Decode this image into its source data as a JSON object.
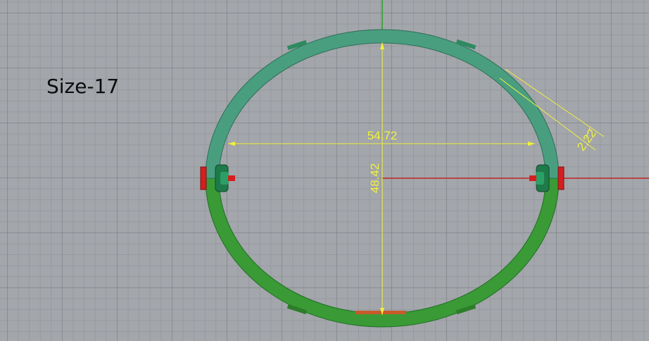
{
  "viewport": {
    "size_label": "Size-17",
    "colors": {
      "background": "#a3a6ab",
      "ring_upper": "#3f9a78",
      "ring_lower": "#3a9a35",
      "dimension": "#f2f23a",
      "x_axis": "#c62828",
      "y_axis": "#28a428",
      "hinge_green": "#1f7a4a",
      "hinge_red": "#d41f1f"
    },
    "dimensions": {
      "width": "54.72",
      "height": "48.42",
      "thickness": "2.22"
    }
  }
}
